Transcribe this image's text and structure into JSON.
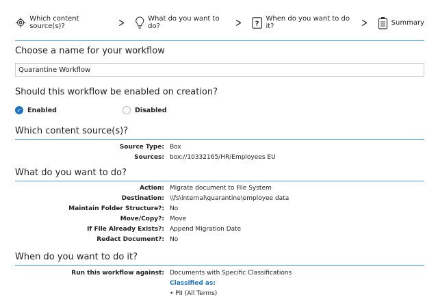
{
  "steps": [
    {
      "label": "Which content source(s)?",
      "icon": "target-icon"
    },
    {
      "label": "What do you want to do?",
      "icon": "lightbulb-icon"
    },
    {
      "label": "When do you want to do it?",
      "icon": "question-icon"
    },
    {
      "label": "Summary",
      "icon": "clipboard-icon"
    }
  ],
  "name_section": {
    "heading": "Choose a name for your workflow",
    "value": "Quarantine Workflow"
  },
  "enable_section": {
    "heading": "Should this workflow be enabled on creation?",
    "options": [
      "Enabled",
      "Disabled"
    ],
    "selected": "Enabled"
  },
  "source_section": {
    "heading": "Which content source(s)?",
    "rows": [
      {
        "label": "Source Type:",
        "value": "Box"
      },
      {
        "label": "Sources:",
        "value": "box://10332165/HR/Employees EU"
      }
    ]
  },
  "action_section": {
    "heading": "What do you want to do?",
    "rows": [
      {
        "label": "Action:",
        "value": "Migrate document to File System"
      },
      {
        "label": "Destination:",
        "value": "\\\\fs\\internal\\quarantine\\employee data"
      },
      {
        "label": "Maintain Folder Structure?:",
        "value": "No"
      },
      {
        "label": "Move/Copy?:",
        "value": "Move"
      },
      {
        "label": "If File Already Exists?:",
        "value": "Append Migration Date"
      },
      {
        "label": "Redact Document?:",
        "value": "No"
      }
    ]
  },
  "when_section": {
    "heading": "When do you want to do it?",
    "label": "Run this workflow against:",
    "value": "Documents with Specific Classifications",
    "classified_label": "Classified as:",
    "classifications": [
      "• PII (All Terms)"
    ]
  }
}
